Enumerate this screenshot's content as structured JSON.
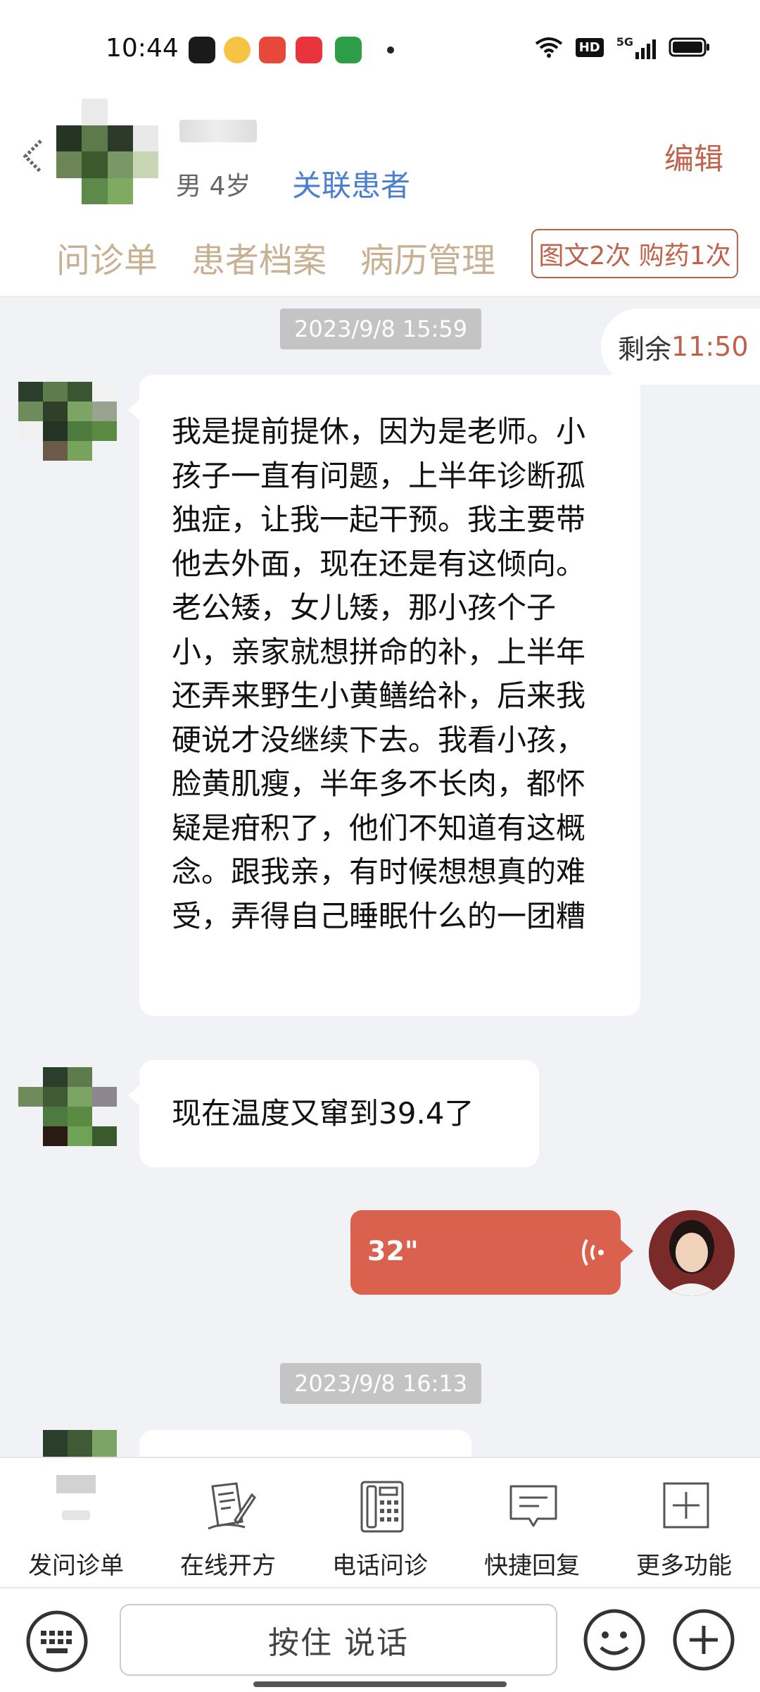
{
  "status_bar": {
    "time": "10:44",
    "net_badge": "HD",
    "signal_label": "5G"
  },
  "header": {
    "patient_info": "男 4岁",
    "link_patient_label": "关联患者",
    "edit_label": "编辑",
    "tabs": [
      {
        "label": "问诊单"
      },
      {
        "label": "患者档案"
      },
      {
        "label": "病历管理"
      }
    ],
    "quota_label": "图文2次 购药1次"
  },
  "chat": {
    "remaining_label": "剩余",
    "remaining_time": "11:50",
    "timestamps": [
      "2023/9/8 15:59",
      "2023/9/8 16:13"
    ],
    "messages": [
      {
        "sender": "patient",
        "text": "我是提前提休，因为是老师。小孩子一直有问题，上半年诊断孤独症，让我一起干预。我主要带他去外面，现在还是有这倾向。老公矮，女儿矮，那小孩个子小，亲家就想拼命的补，上半年还弄来野生小黄鳝给补，后来我硬说才没继续下去。我看小孩，脸黄肌瘦，半年多不长肉，都怀疑是疳积了，他们不知道有这概念。跟我亲，有时候想想真的难受，弄得自己睡眠什么的一团糟"
      },
      {
        "sender": "patient",
        "text": "现在温度又窜到39.4了"
      },
      {
        "sender": "doctor",
        "type": "voice",
        "duration": "32\""
      }
    ]
  },
  "toolbar": {
    "items": [
      {
        "label": "发问诊单",
        "icon": "questionnaire-icon"
      },
      {
        "label": "在线开方",
        "icon": "prescription-icon"
      },
      {
        "label": "电话问诊",
        "icon": "phone-icon"
      },
      {
        "label": "快捷回复",
        "icon": "quick-reply-icon"
      },
      {
        "label": "更多功能",
        "icon": "more-plus-icon"
      }
    ]
  },
  "input": {
    "hold_to_talk": "按住 说话"
  },
  "colors": {
    "accent": "#c0614a",
    "link": "#4a7fd0",
    "tab": "#c8b193",
    "voice_bubble": "#d9614e",
    "background": "#f1f2f6"
  }
}
